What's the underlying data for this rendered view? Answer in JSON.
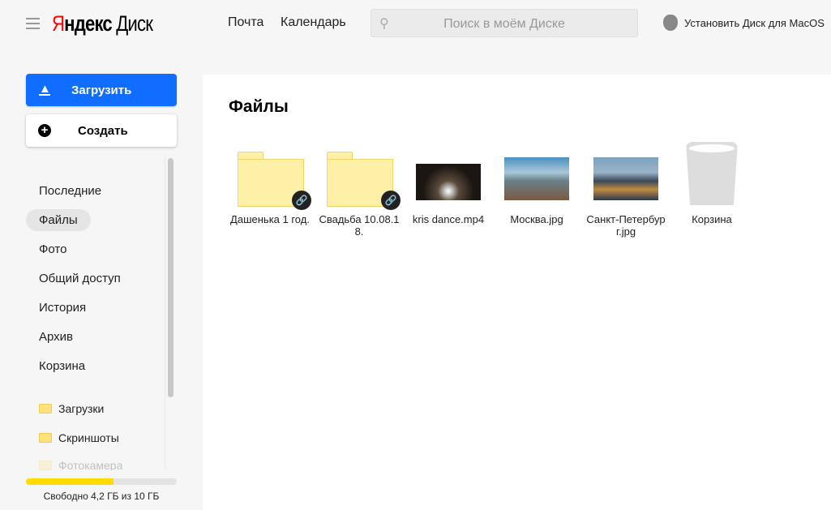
{
  "header": {
    "logo_red": "Я",
    "logo_black": "ндекс",
    "logo_product": "Диск",
    "links": [
      "Почта",
      "Календарь"
    ],
    "search_placeholder": "Поиск в моём Диске",
    "install_label": "Установить Диск для MacOS"
  },
  "sidebar": {
    "upload_label": "Загрузить",
    "create_label": "Создать",
    "nav": [
      "Последние",
      "Файлы",
      "Фото",
      "Общий доступ",
      "История",
      "Архив",
      "Корзина"
    ],
    "active": "Файлы",
    "folders": [
      "Загрузки",
      "Скриншоты",
      "Фотокамера"
    ],
    "storage": {
      "used_fraction": 0.58,
      "text": "Свободно 4,2 ГБ из 10 ГБ",
      "color": "#ffdb00"
    }
  },
  "main": {
    "title": "Файлы",
    "items": [
      {
        "name": "Дашенька 1 год.",
        "type": "folder",
        "shared": true
      },
      {
        "name": "Свадьба 10.08.18.",
        "type": "folder",
        "shared": true
      },
      {
        "name": "kris dance.mp4",
        "type": "video"
      },
      {
        "name": "Москва.jpg",
        "type": "image"
      },
      {
        "name": "Санкт-Петербург.jpg",
        "type": "image"
      },
      {
        "name": "Корзина",
        "type": "trash"
      }
    ]
  }
}
